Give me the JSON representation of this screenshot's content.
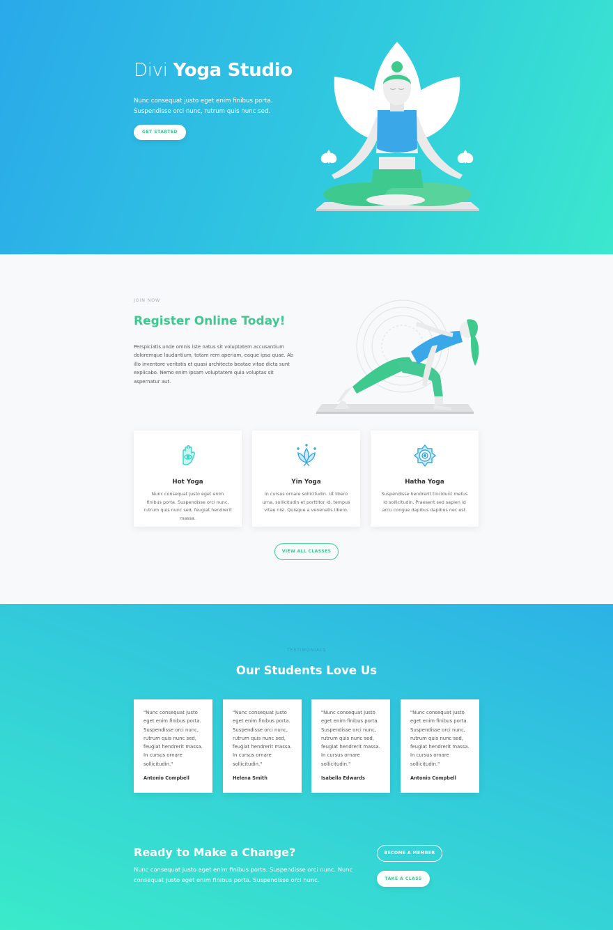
{
  "hero": {
    "title_light": "Divi ",
    "title_bold": "Yoga Studio",
    "text": "Nunc consequat justo eget enim finibus porta. Suspendisse orci nunc, rutrum quis nunc sed.",
    "button": "GET STARTED"
  },
  "register": {
    "kicker": "JOIN NOW",
    "title": "Register Online Today!",
    "text": "Perspiciatis unde omnis iste natus sit voluptatem accusantium doloremque laudantium, totam rem aperiam, eaque ipsa quae. Ab illo inventore veritatis et quasi architecto beatae vitae dicta sunt explicabo. Nemo enim ipsam voluptatem quia voluptas sit aspernatur aut.",
    "cards": [
      {
        "icon": "hamsa-hand-icon",
        "title": "Hot Yoga",
        "text": "Nunc consequat justo eget enim finibus porta. Suspendisse orci nunc, rutrum quis nunc sed, feugiat hendrerit massa."
      },
      {
        "icon": "lotus-icon",
        "title": "Yin Yoga",
        "text": "In cursus ornare sollicitudin. Ut libero urna, sollicitudin et porttitor id, tempus vitae nisl. Quisque a venenatis libero."
      },
      {
        "icon": "chakra-icon",
        "title": "Hatha Yoga",
        "text": "Suspendisse hendrerit tincidunt metus id sollicitudin. Praesent sed sapien id arcu congue dapibus dapibus nec est."
      }
    ],
    "view_button": "VIEW ALL CLASSES"
  },
  "testimonials": {
    "kicker": "TESTIMONIALS",
    "title": "Our Students Love Us",
    "items": [
      {
        "quote": "\"Nunc consequat justo eget enim finibus porta. Suspendisse orci nunc, rutrum quis nunc sed, feugiat hendrerit massa. In cursus ornare sollicitudin.\"",
        "name": "Antonio Compbell"
      },
      {
        "quote": "\"Nunc consequat justo eget enim finibus porta. Suspendisse orci nunc, rutrum quis nunc sed, feugiat hendrerit massa. In cursus ornare sollicitudin.\"",
        "name": "Helena Smith"
      },
      {
        "quote": "\"Nunc consequat justo eget enim finibus porta. Suspendisse orci nunc, rutrum quis nunc sed, feugiat hendrerit massa. In cursus ornare sollicitudin.\"",
        "name": "Isabella Edwards"
      },
      {
        "quote": "\"Nunc consequat justo eget enim finibus porta. Suspendisse orci nunc, rutrum quis nunc sed, feugiat hendrerit massa. In cursus ornare sollicitudin.\"",
        "name": "Antonio Compbell"
      }
    ]
  },
  "cta": {
    "title": "Ready to Make a Change?",
    "text": "Nunc consequat justo eget enim finibus porta. Suspendisse orci nunc. Nunc consequat justo eget enim finibus porta. Suspendisse orci nunc.",
    "member_button": "BECOME A MEMBER",
    "class_button": "TAKE A CLASS"
  },
  "colors": {
    "accent_green": "#3ec98f",
    "hero_blue": "#2aa9ea",
    "hero_teal": "#3be8cd",
    "icon_teal": "#33d6c9"
  }
}
